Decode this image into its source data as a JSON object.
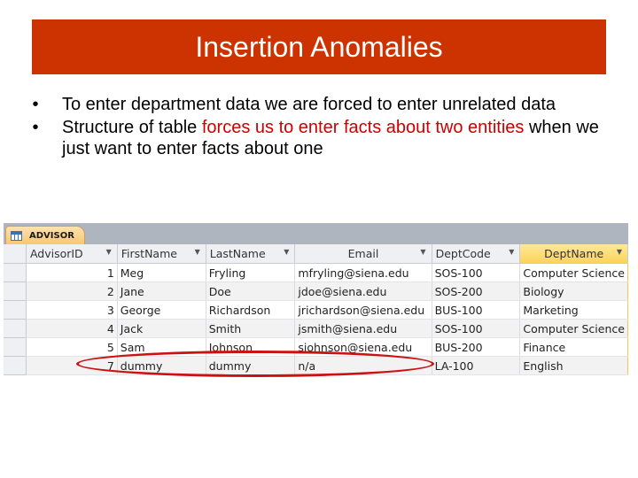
{
  "slide": {
    "title": "Insertion Anomalies",
    "bullets": [
      {
        "segments": [
          {
            "text": "To enter department data we are forced to enter unrelated data",
            "highlight": false
          }
        ]
      },
      {
        "segments": [
          {
            "text": "Structure of table ",
            "highlight": false
          },
          {
            "text": "forces us to enter facts about two entities",
            "highlight": true
          },
          {
            "text": " when we just want to enter facts about one",
            "highlight": false
          }
        ]
      }
    ],
    "colors": {
      "title_bg": "#cc3300",
      "highlight": "#cc0000",
      "annotation": "#cc1111"
    }
  },
  "access_table": {
    "tab_label": "ADVISOR",
    "tab_icon": "table-icon",
    "columns": [
      "AdvisorID",
      "FirstName",
      "LastName",
      "Email",
      "DeptCode",
      "DeptName"
    ],
    "selected_column": "DeptName",
    "rows": [
      [
        "1",
        "Meg",
        "Fryling",
        "mfryling@siena.edu",
        "SOS-100",
        "Computer Science"
      ],
      [
        "2",
        "Jane",
        "Doe",
        "jdoe@siena.edu",
        "SOS-200",
        "Biology"
      ],
      [
        "3",
        "George",
        "Richardson",
        "jrichardson@siena.edu",
        "BUS-100",
        "Marketing"
      ],
      [
        "4",
        "Jack",
        "Smith",
        "jsmith@siena.edu",
        "SOS-100",
        "Computer Science"
      ],
      [
        "5",
        "Sam",
        "Johnson",
        "sjohnson@siena.edu",
        "BUS-200",
        "Finance"
      ],
      [
        "7",
        "dummy",
        "dummy",
        "n/a",
        "LA-100",
        "English"
      ]
    ],
    "annotated_row": 5
  }
}
